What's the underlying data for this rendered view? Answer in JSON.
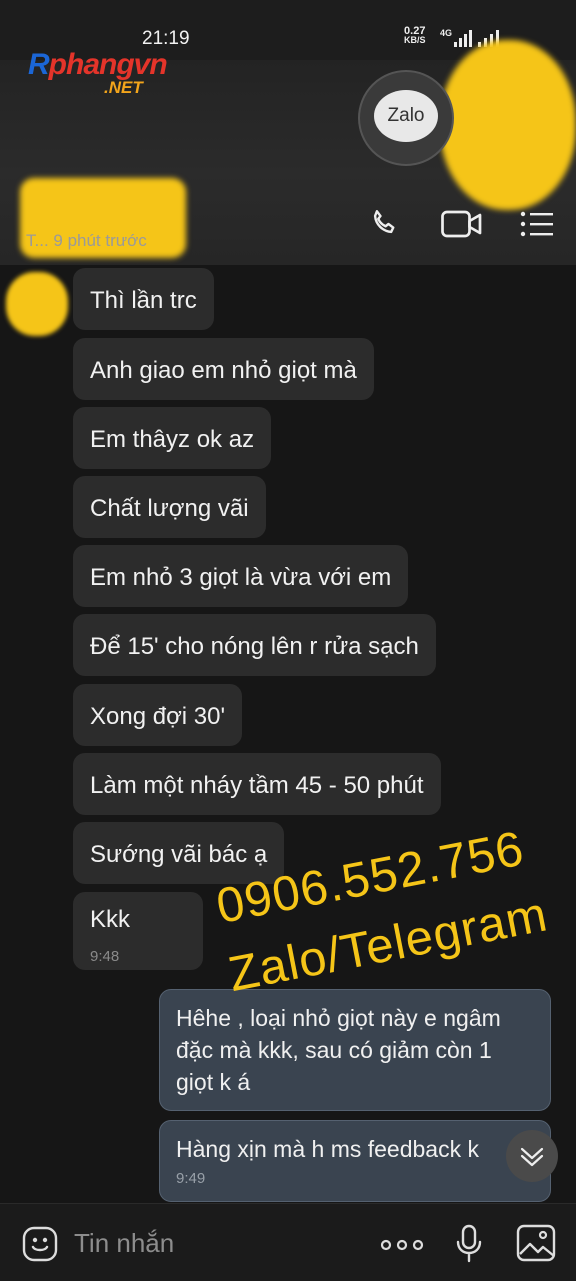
{
  "status": {
    "time": "21:19",
    "net_speed": "0.27",
    "net_unit": "KB/S",
    "network": "4G"
  },
  "watermark_logo": {
    "first": "R",
    "rest": "phangvn",
    "suffix": ".NET"
  },
  "header": {
    "app_badge": "Zalo",
    "last_seen": "T... 9 phút trước",
    "icons": [
      "phone-icon",
      "video-call-icon",
      "menu-icon"
    ]
  },
  "messages": [
    {
      "text": "Thì lần trc"
    },
    {
      "text": "Anh giao em nhỏ giọt mà"
    },
    {
      "text": "Em thâyz ok az"
    },
    {
      "text": "Chất lượng vãi"
    },
    {
      "text": "Em nhỏ 3 giọt là vừa với em"
    },
    {
      "text": "Để 15' cho nóng lên r rửa sạch"
    },
    {
      "text": "Xong đợi 30'"
    },
    {
      "text": "Làm một nháy tầm 45 - 50 phút"
    },
    {
      "text": "Sướng vãi bác ạ"
    },
    {
      "text": "Kkk",
      "time": "9:48"
    }
  ],
  "outgoing": [
    {
      "text": "Hêhe , loại nhỏ giọt này e ngâm đặc mà kkk, sau có giảm còn 1 giọt k á"
    },
    {
      "text": "Hàng xịn mà h ms feedback k",
      "time": "9:49"
    }
  ],
  "overlay": {
    "phone": "0906.552.756",
    "channels": "Zalo/Telegram"
  },
  "composer": {
    "placeholder": "Tin nhắn"
  }
}
